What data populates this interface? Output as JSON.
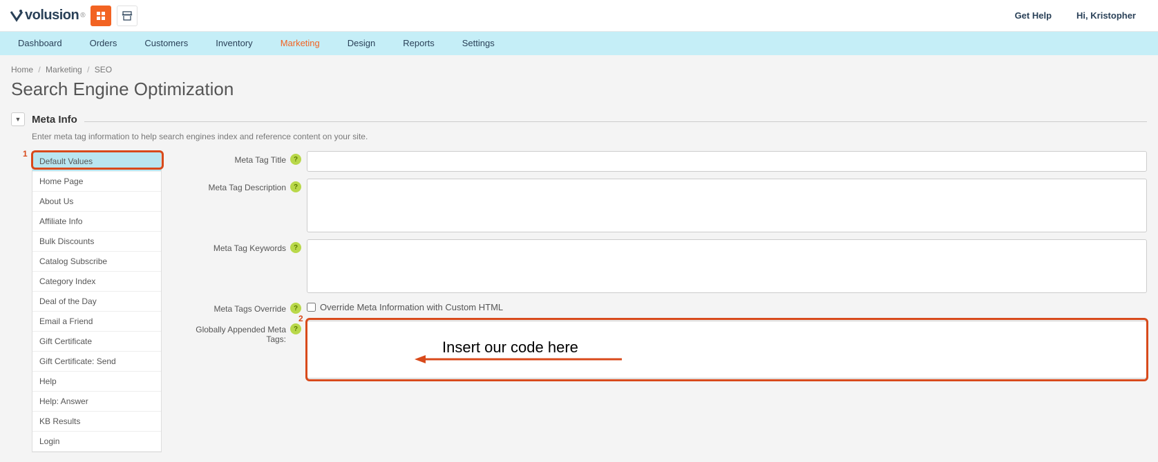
{
  "topbar": {
    "brand": "volusion",
    "get_help": "Get Help",
    "greeting": "Hi, Kristopher"
  },
  "nav": {
    "items": [
      {
        "label": "Dashboard"
      },
      {
        "label": "Orders"
      },
      {
        "label": "Customers"
      },
      {
        "label": "Inventory"
      },
      {
        "label": "Marketing",
        "active": true
      },
      {
        "label": "Design"
      },
      {
        "label": "Reports"
      },
      {
        "label": "Settings"
      }
    ]
  },
  "breadcrumb": {
    "home": "Home",
    "marketing": "Marketing",
    "seo": "SEO"
  },
  "page_title": "Search Engine Optimization",
  "section": {
    "title": "Meta Info",
    "desc": "Enter meta tag information to help search engines index and reference content on your site."
  },
  "sidebar": {
    "items": [
      {
        "label": "Default Values",
        "active": true
      },
      {
        "label": "Home Page"
      },
      {
        "label": "About Us"
      },
      {
        "label": "Affiliate Info"
      },
      {
        "label": "Bulk Discounts"
      },
      {
        "label": "Catalog Subscribe"
      },
      {
        "label": "Category Index"
      },
      {
        "label": "Deal of the Day"
      },
      {
        "label": "Email a Friend"
      },
      {
        "label": "Gift Certificate"
      },
      {
        "label": "Gift Certificate: Send"
      },
      {
        "label": "Help"
      },
      {
        "label": "Help: Answer"
      },
      {
        "label": "KB Results"
      },
      {
        "label": "Login"
      }
    ]
  },
  "form": {
    "meta_title_label": "Meta Tag Title",
    "meta_desc_label": "Meta Tag Description",
    "meta_keywords_label": "Meta Tag Keywords",
    "meta_override_label": "Meta Tags Override",
    "meta_override_checkbox": "Override Meta Information with Custom HTML",
    "global_appended_label": "Globally Appended Meta Tags:",
    "meta_title_value": "",
    "meta_desc_value": "",
    "meta_keywords_value": "",
    "global_appended_value": ""
  },
  "annotations": {
    "callout1": "1",
    "callout2": "2",
    "insert_text": "Insert our code here"
  },
  "icons": {
    "help_glyph": "?"
  }
}
